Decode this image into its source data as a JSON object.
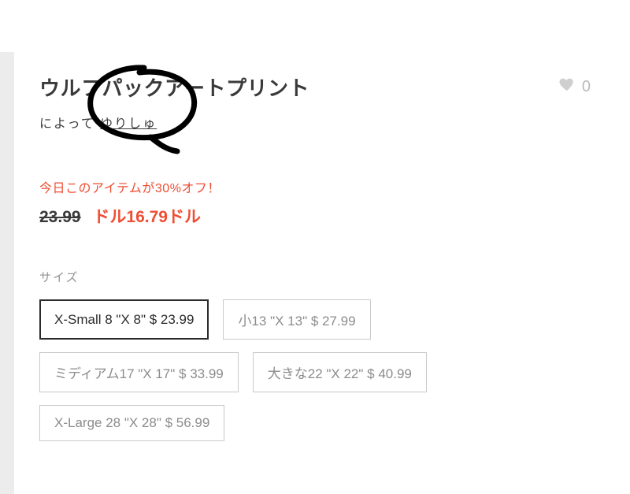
{
  "product": {
    "title": "ウルフパックアートプリント",
    "byline_prefix": "によって ",
    "author": "ゆりしゅ"
  },
  "favorite": {
    "count": "0"
  },
  "pricing": {
    "promo_text": "今日このアイテムが30%オフ！",
    "old_price": "23.99",
    "new_price_prefix": "ドル",
    "new_price_value": "16.79",
    "new_price_suffix": "ドル"
  },
  "size": {
    "label": "サイズ",
    "options": [
      {
        "label": "X-Small 8 \"X 8\" $ 23.99",
        "selected": true
      },
      {
        "label": "小13 \"X 13\" $ 27.99",
        "selected": false
      },
      {
        "label": "ミディアム17 \"X 17\" $ 33.99",
        "selected": false
      },
      {
        "label": "大きな22 \"X 22\" $ 40.99",
        "selected": false
      },
      {
        "label": "X-Large 28 \"X 28\" $ 56.99",
        "selected": false
      }
    ]
  }
}
